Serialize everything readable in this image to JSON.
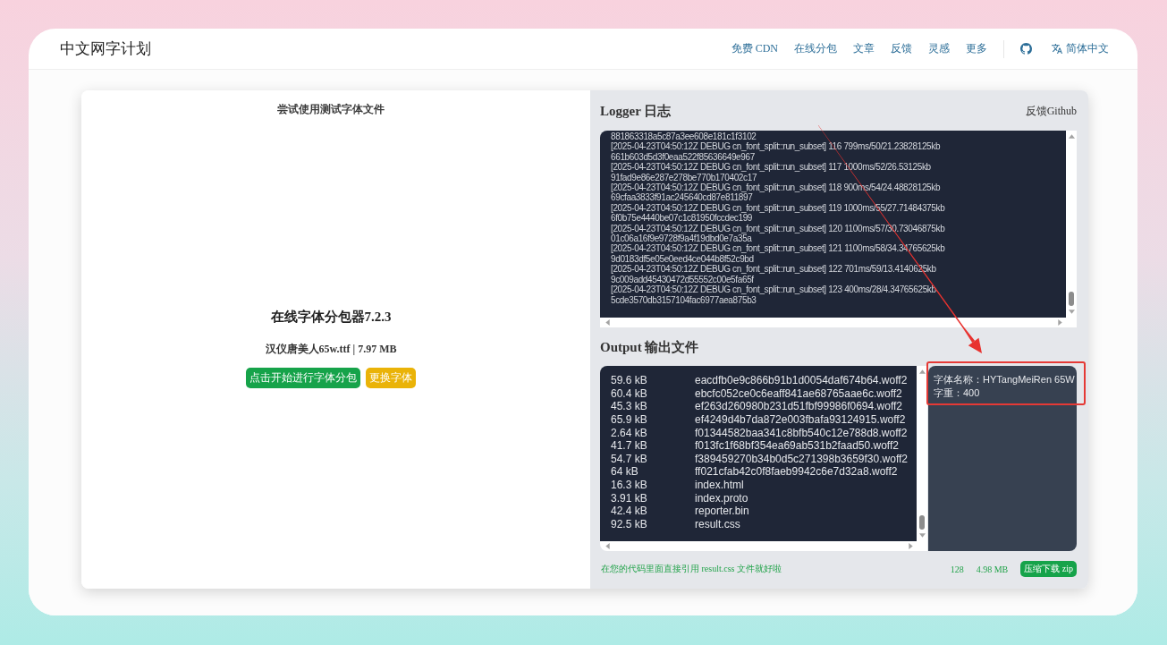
{
  "header": {
    "title": "中文网字计划",
    "nav": [
      "免费 CDN",
      "在线分包",
      "文章",
      "反馈",
      "灵感",
      "更多"
    ],
    "language": "简体中文"
  },
  "left_panel": {
    "caption": "尝试使用测试字体文件",
    "title": "在线字体分包器7.2.3",
    "file_info": "汉仪唐美人65w.ttf | 7.97 MB",
    "buttons": [
      {
        "label": "点击开始进行字体分包",
        "kind": "primary"
      },
      {
        "label": "更换字体",
        "kind": "secondary"
      }
    ]
  },
  "logger": {
    "title": "Logger 日志",
    "link": "反馈Github",
    "lines": [
      "881863318a5c87a3ee608e181c1f3102",
      "[2025-04-23T04:50:12Z DEBUG cn_font_split::run_subset] 116 799ms/50/21.23828125kb",
      "661b603d5d3f0eaa522f85636649e967",
      "[2025-04-23T04:50:12Z DEBUG cn_font_split::run_subset] 117 1000ms/52/26.53125kb",
      "91fad9e86e287e278be770b170402c17",
      "[2025-04-23T04:50:12Z DEBUG cn_font_split::run_subset] 118 900ms/54/24.48828125kb",
      "69cfaa3833f91ac245640cd87e811897",
      "[2025-04-23T04:50:12Z DEBUG cn_font_split::run_subset] 119 1000ms/55/27.71484375kb",
      "6f0b75e4440be07c1c81950fccdec199",
      "[2025-04-23T04:50:12Z DEBUG cn_font_split::run_subset] 120 1100ms/57/30.73046875kb",
      "01c06a16f9e9728f9a4f19dbd0e7a35a",
      "[2025-04-23T04:50:12Z DEBUG cn_font_split::run_subset] 121 1100ms/58/34.34765625kb",
      "9d0183df5e05e0eed4ce044b8f52c9bd",
      "[2025-04-23T04:50:12Z DEBUG cn_font_split::run_subset] 122 701ms/59/13.4140625kb",
      "9c009add45430472d55552c00e5fa65f",
      "[2025-04-23T04:50:12Z DEBUG cn_font_split::run_subset] 123 400ms/28/4.34765625kb",
      "5cde3570db3157104fac6977aea875b3"
    ]
  },
  "output": {
    "title": "Output 输出文件",
    "files": [
      {
        "size": "59.6 kB",
        "name": "eacdfb0e9c866b91b1d0054daf674b64.woff2"
      },
      {
        "size": "60.4 kB",
        "name": "ebcfc052ce0c6eaff841ae68765aae6c.woff2"
      },
      {
        "size": "45.3 kB",
        "name": "ef263d260980b231d51fbf99986f0694.woff2"
      },
      {
        "size": "65.9 kB",
        "name": "ef4249d4b7da872e003fbafa93124915.woff2"
      },
      {
        "size": "2.64 kB",
        "name": "f01344582baa341c8bfb540c12e788d8.woff2"
      },
      {
        "size": "41.7 kB",
        "name": "f013fc1f68bf354ea69ab531b2faad50.woff2"
      },
      {
        "size": "54.7 kB",
        "name": "f389459270b34b0d5c271398b3659f30.woff2"
      },
      {
        "size": "64 kB",
        "name": "ff021cfab42c0f8faeb9942c6e7d32a8.woff2"
      },
      {
        "size": "16.3 kB",
        "name": "index.html"
      },
      {
        "size": "3.91 kB",
        "name": "index.proto"
      },
      {
        "size": "42.4 kB",
        "name": "reporter.bin"
      },
      {
        "size": "92.5 kB",
        "name": "result.css"
      }
    ],
    "font_info": [
      "字体名称：HYTangMeiRen 65W",
      "字重：400"
    ],
    "hint": "在您的代码里面直接引用 result.css 文件就好啦",
    "file_count": "128",
    "total_size": "4.98 MB",
    "download_button": "压缩下载 zip"
  },
  "annotations": {
    "arrow": true,
    "highlight_frame": true
  }
}
